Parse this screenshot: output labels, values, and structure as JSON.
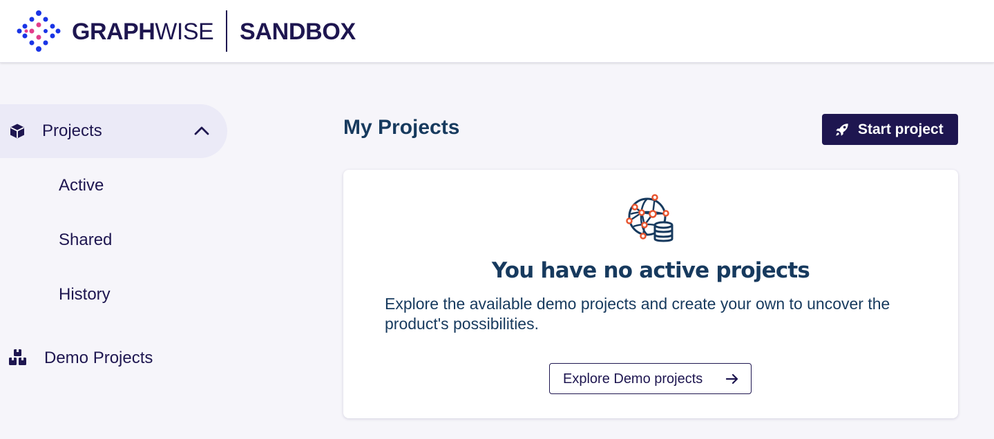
{
  "header": {
    "brand_bold": "GRAPH",
    "brand_light": "WISE",
    "product": "SANDBOX"
  },
  "sidebar": {
    "projects": {
      "label": "Projects",
      "icon": "cube-icon",
      "expanded": true,
      "toggle_icon": "chevron-up-icon",
      "children": [
        {
          "label": "Active"
        },
        {
          "label": "Shared"
        },
        {
          "label": "History"
        }
      ]
    },
    "demo": {
      "label": "Demo Projects",
      "icon": "boxes-icon"
    }
  },
  "main": {
    "title": "My Projects",
    "start_button": {
      "label": "Start project",
      "icon": "rocket-icon"
    },
    "empty_state": {
      "icon": "graph-database-icon",
      "title": "You have no active projects",
      "text": "Explore the available demo projects and create your own to uncover the product's possibilities.",
      "button": {
        "label": "Explore Demo projects",
        "icon": "arrow-right-icon"
      }
    }
  },
  "colors": {
    "brand_dark": "#1e1650",
    "heading": "#173a5e",
    "accent_orange": "#e8552f",
    "logo_blue": "#1a35e6",
    "logo_pink": "#e23d8b",
    "active_nav_bg": "#ebeaf7",
    "page_bg": "#f6f5fa"
  }
}
